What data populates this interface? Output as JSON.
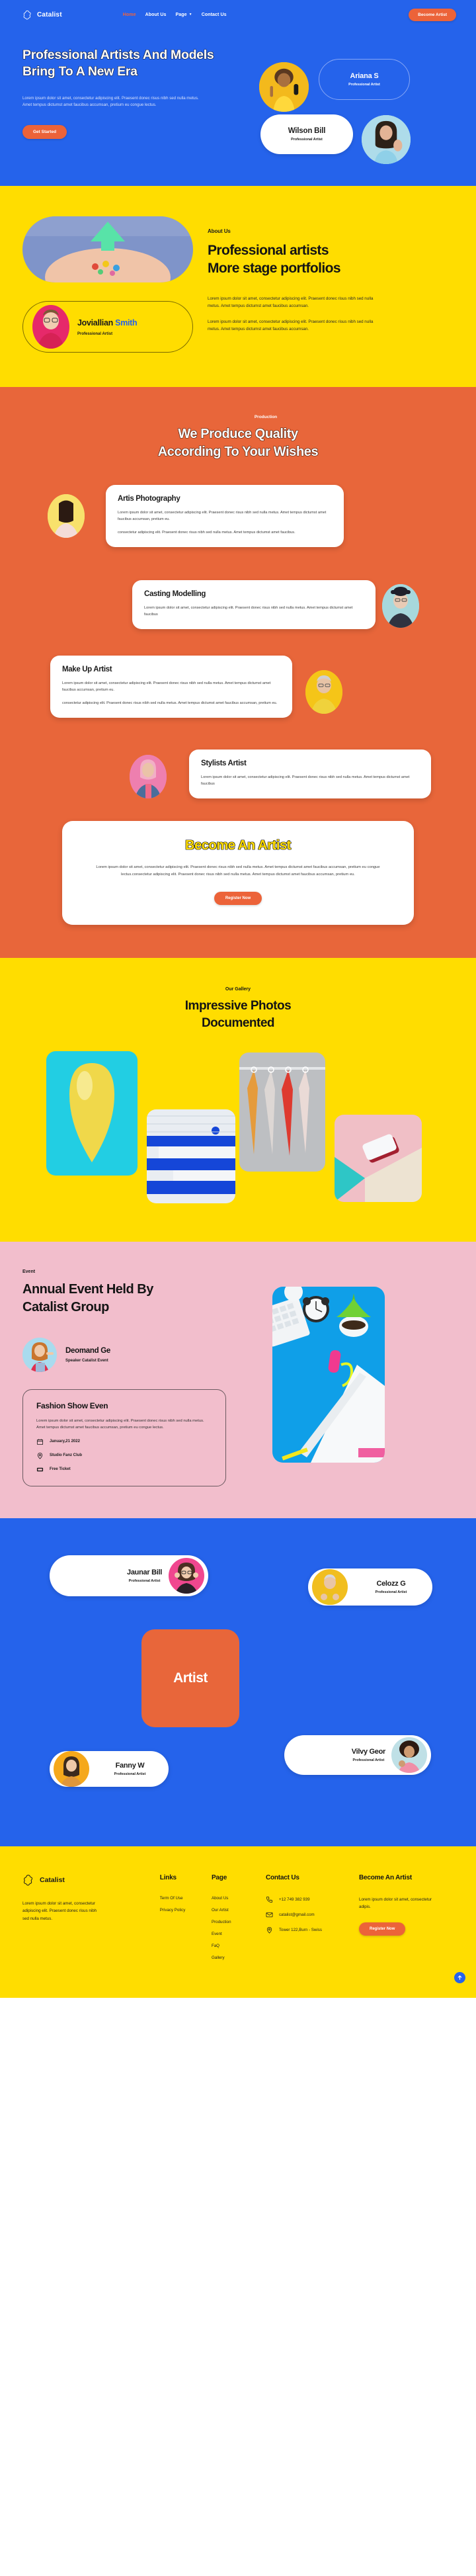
{
  "brand": {
    "name": "Catalist",
    "logo_icon": "blob-logo-icon"
  },
  "nav": {
    "links": [
      {
        "label": "Home",
        "active": true
      },
      {
        "label": "About Us",
        "active": false
      },
      {
        "label": "Page",
        "active": false,
        "has_caret": true
      },
      {
        "label": "Contact Us",
        "active": false
      }
    ],
    "cta_label": "Become Artist"
  },
  "hero": {
    "title": "Professional Artists And Models Bring To A New Era",
    "description": "Lorem ipsum dolor sit amet, consectetur adipiscing elit. Praesent donec risus nibh sed nulla metus. Amet tempus dictumst amet faucibus accumsan, pretium eu congue lectus.",
    "cta_label": "Get Started",
    "cards": [
      {
        "name": "Ariana S",
        "role": "Professional Artist",
        "style": "outline"
      },
      {
        "name": "Wilson Bill",
        "role": "Professional Artist",
        "style": "white"
      }
    ],
    "avatars": [
      "artist-yellow-avatar",
      "artist-blue-avatar"
    ]
  },
  "about": {
    "eyebrow": "About Us",
    "title_line1": "Professional artists",
    "title_line2": "More stage portfolios",
    "paragraph1": "Lorem ipsum dolor sit amet, consectetur adipiscing elit. Praesent donec risus nibh sed nulla metus. Amet tempus dictumst amet faucibus accumsan.",
    "paragraph2": "Lorem ipsum dolor sit amet, consectetur adipiscing elit. Praesent donec risus nibh sed nulla metus. Amet tempus dictumst amet faucibus accumsan.",
    "person": {
      "first_name": "Joviallian ",
      "last_name": "Smith",
      "role": "Professional Artist"
    }
  },
  "production": {
    "eyebrow": "Production",
    "title_line1": "We Produce Quality",
    "title_line2": "According To Your Wishes",
    "services": [
      {
        "title": "Artis Photography",
        "p1": "Lorem ipsum dolor sit amet, consectetur adipiscing elit. Praesent donec risus nibh sed nulla metus. Amet tempus dictumst amet faucibus accumsan, pretium eu.",
        "p2": "consectetur adipiscing elit. Praesent donec risus nibh sed nulla metus. Amet tempus dictumst amet faucibus."
      },
      {
        "title": "Casting Modelling",
        "p1": "Lorem ipsum dolor sit amet, consectetur adipiscing elit. Praesent donec risus nibh sed nulla metus. Amet tempus dictumst amet faucibus",
        "p2": ""
      },
      {
        "title": "Make Up Artist",
        "p1": "Lorem ipsum dolor sit amet, consectetur adipiscing elit. Praesent donec risus nibh sed nulla metus. Amet tempus dictumst amet faucibus accumsan, pretium eu.",
        "p2": "consectetur adipiscing elit. Praesent donec risus nibh sed nulla metus. Amet tempus dictumst amet faucibus accumsan, pretium eu."
      },
      {
        "title": "Stylists Artist",
        "p1": "Lorem ipsum dolor sit amet, consectetur adipiscing elit. Praesent donec risus nibh sed nulla metus. Amet tempus dictumst amet faucibus",
        "p2": ""
      }
    ],
    "cta": {
      "title": "Become An Artist",
      "paragraph": "Lorem ipsum dolor sit amet, consectetur adipiscing elit. Praesent donec risus nibh sed nulla metus. Amet tempus dictumst amet faucibus accumsan, pretium eu congue lectus.consectetur adipiscing elit. Praesent donec risus nibh sed nulla metus. Amet tempus dictumst amet faucibus accumsan, pretium eu.",
      "button_label": "Register Now"
    }
  },
  "gallery": {
    "eyebrow": "Our Gallery",
    "title_line1": "Impressive Photos",
    "title_line2": "Documented",
    "items": [
      {
        "name": "yellow-balloon-photo"
      },
      {
        "name": "clothes-rack-photo"
      },
      {
        "name": "blue-white-stairs-photo"
      },
      {
        "name": "phone-on-pink-photo"
      }
    ]
  },
  "event": {
    "eyebrow": "Event",
    "title_line1": "Annual Event Held By",
    "title_line2": "Catalist Group",
    "speaker": {
      "name": "Deomand Ge",
      "role": "Speaker Catalist Event"
    },
    "card": {
      "title": "Fashion Show Even",
      "paragraph": "Lorem ipsum dolor sit amet, consectetur adipiscing elit. Praesent donec risus nibh sed nulla metus. Amet tempus dictumst amet faucibus accumsan, pretium eu congue lectus.",
      "meta": [
        {
          "icon": "calendar-icon",
          "text": "January,21 2022"
        },
        {
          "icon": "location-pin-icon",
          "text": "Studio Fanz Club"
        },
        {
          "icon": "ticket-icon",
          "text": "Free Ticket"
        }
      ]
    },
    "photo": "desk-flatlay-photo"
  },
  "artists": {
    "center_label": "Artist",
    "cards": [
      {
        "name": "Jaunar Bill",
        "role": "Professional Artist",
        "avatar_side": "right"
      },
      {
        "name": "Celozz G",
        "role": "Professional Artist",
        "avatar_side": "left"
      },
      {
        "name": "Fanny W",
        "role": "Professional Artist",
        "avatar_side": "left"
      },
      {
        "name": "Vilvy Geor",
        "role": "Professional Artist",
        "avatar_side": "right"
      }
    ]
  },
  "footer": {
    "brand_name": "Catalist",
    "about": "Lorem ipsum dolor sit amet, consectetur adipiscing elit. Praesent donec risus nibh sed nulla metus.",
    "links_heading": "Links",
    "links": [
      "Term Of Use",
      "Privacy Policy"
    ],
    "page_heading": "Page",
    "pages": [
      "About Us",
      "Our Artist",
      "Production",
      "Event",
      "FaQ",
      "Gallery"
    ],
    "contact_heading": "Contact Us",
    "contacts": [
      {
        "icon": "phone-icon",
        "text": "+12 749 382 939"
      },
      {
        "icon": "mail-icon",
        "text": "catalist@gmail.com"
      },
      {
        "icon": "location-pin-icon",
        "text": "Tower 122,Burn - Swiss"
      }
    ],
    "become_heading": "Become An Artist",
    "become_text": "Lorem ipsum dolor sit amet, consectetur adipis.",
    "become_button": "Register Now",
    "back_to_top_icon": "arrow-up-circle-icon"
  },
  "colors": {
    "blue": "#2563EB",
    "yellow": "#FFDD00",
    "orange": "#E8663A",
    "orange_button": "#EC6339",
    "pink": "#F2BECC",
    "dark": "#141414"
  }
}
